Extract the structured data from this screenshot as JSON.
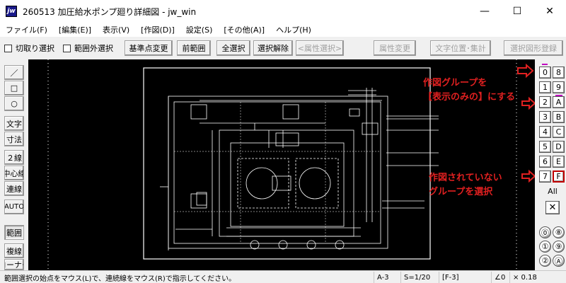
{
  "window": {
    "title": "260513 加圧給水ポンプ廻り詳細図 - jw_win",
    "app_icon": "jw",
    "minimize": "—",
    "maximize": "☐",
    "close": "✕"
  },
  "menu": [
    "ファイル(F)",
    "[編集(E)]",
    "表示(V)",
    "[作図(D)]",
    "設定(S)",
    "[その他(A)]",
    "ヘルプ(H)"
  ],
  "toolbar": {
    "check_cut": "切取り選択",
    "check_outside": "範囲外選択",
    "btn_basepoint": "基準点変更",
    "btn_prev_range": "前範囲",
    "btn_select_all": "全選択",
    "btn_deselect": "選択解除",
    "btn_attr_select": "<属性選択>",
    "btn_attr_change": "属性変更",
    "btn_text_pos": "文字位置･集計",
    "btn_register": "選択図形登録"
  },
  "left_tools": {
    "line": "／",
    "rect": "□",
    "circle": "○",
    "text": "文字",
    "dim": "寸法",
    "double_line": "２線",
    "center_line": "中心線",
    "continuous": "連線",
    "auto": "AUTO",
    "range": "範囲",
    "copy_line": "複線",
    "corner": "コーナー"
  },
  "layer_groups": {
    "row1": [
      "0",
      "8"
    ],
    "row2": [
      "1",
      "9"
    ],
    "row3": [
      "2",
      "A"
    ],
    "row4": [
      "3",
      "B"
    ],
    "row5": [
      "4",
      "C"
    ],
    "row6": [
      "5",
      "D"
    ],
    "row7": [
      "6",
      "E"
    ],
    "row8": [
      "7",
      "F"
    ],
    "all": "All",
    "x": "✕",
    "circle0": "⓪",
    "circle1": "⑧",
    "circle2": "①",
    "circle3": "⑨",
    "circle4": "②",
    "circle5": "Ⓐ"
  },
  "annotations": {
    "note1_line1": "作図グループを",
    "note1_line2": "【表示のみの】にする",
    "note2_line1": "作図されていない",
    "note2_line2": "グループを選択"
  },
  "status": {
    "message": "範囲選択の始点をマウス(L)で、連続線をマウス(R)で指示してください。",
    "paper": "A-3",
    "scale": "S=1/20",
    "layer": "[F-3]",
    "angle": "∠0",
    "factor": "× 0.18"
  },
  "colors": {
    "canvas_bg": "#000000",
    "drawing": "#ffffff",
    "annotation": "#e02020"
  }
}
